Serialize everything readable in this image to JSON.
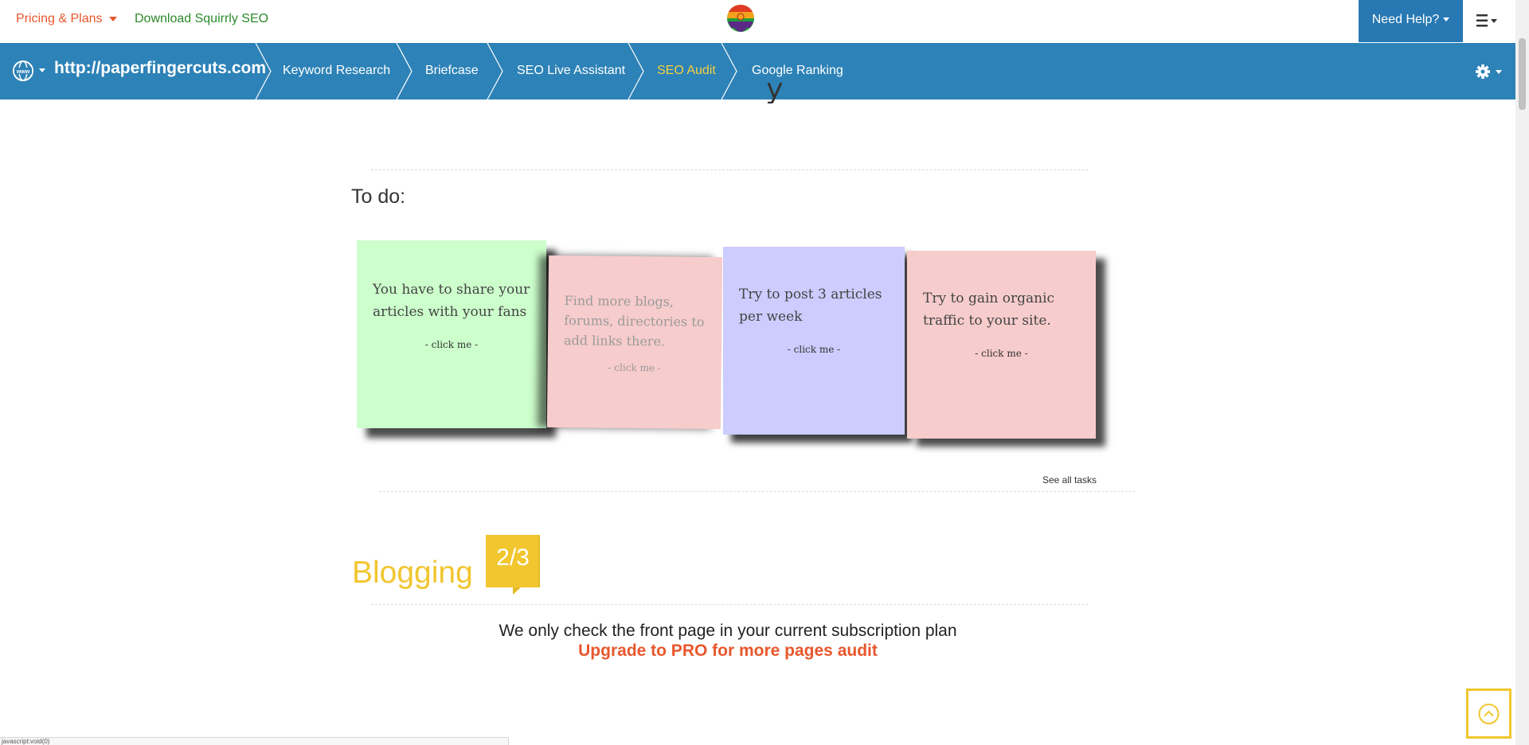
{
  "topbar": {
    "pricing_label": "Pricing & Plans",
    "download_label": "Download Squirrly SEO",
    "need_help_label": "Need Help?"
  },
  "nav": {
    "domain": "http://paperfingercuts.com",
    "crumbs": [
      {
        "label": "Keyword Research",
        "active": false
      },
      {
        "label": "Briefcase",
        "active": false
      },
      {
        "label": "SEO Live Assistant",
        "active": false
      },
      {
        "label": "SEO Audit",
        "active": true
      },
      {
        "label": "Google Ranking",
        "active": false
      }
    ]
  },
  "todo": {
    "title": "To do:",
    "notes": [
      {
        "text": "You have to share your articles with your fans",
        "click": "- click me -",
        "color": "#ccffcc"
      },
      {
        "text": "Find more blogs, forums, directories to add links there.",
        "click": "- click me -",
        "color": "#f7cccc"
      },
      {
        "text": "Try to post 3 articles per week",
        "click": "- click me -",
        "color": "#ccccff"
      },
      {
        "text": "Try to gain organic traffic to your site.",
        "click": "- click me -",
        "color": "#f7cccc"
      }
    ],
    "see_all": "See all tasks"
  },
  "blogging": {
    "title": "Blogging",
    "score": "2/3"
  },
  "notice": {
    "message": "We only check the front page in your current subscription plan",
    "upgrade": "Upgrade to PRO for more pages audit"
  },
  "statusbar": {
    "text": "javascript:void(0)"
  },
  "colors": {
    "nav_blue": "#2d82b7",
    "need_help_blue": "#2778b3",
    "accent_orange": "#e8572d",
    "download_green": "#2b8a2b",
    "active_crumb": "#f4d03f",
    "blogging_yellow": "#f1c62f"
  }
}
